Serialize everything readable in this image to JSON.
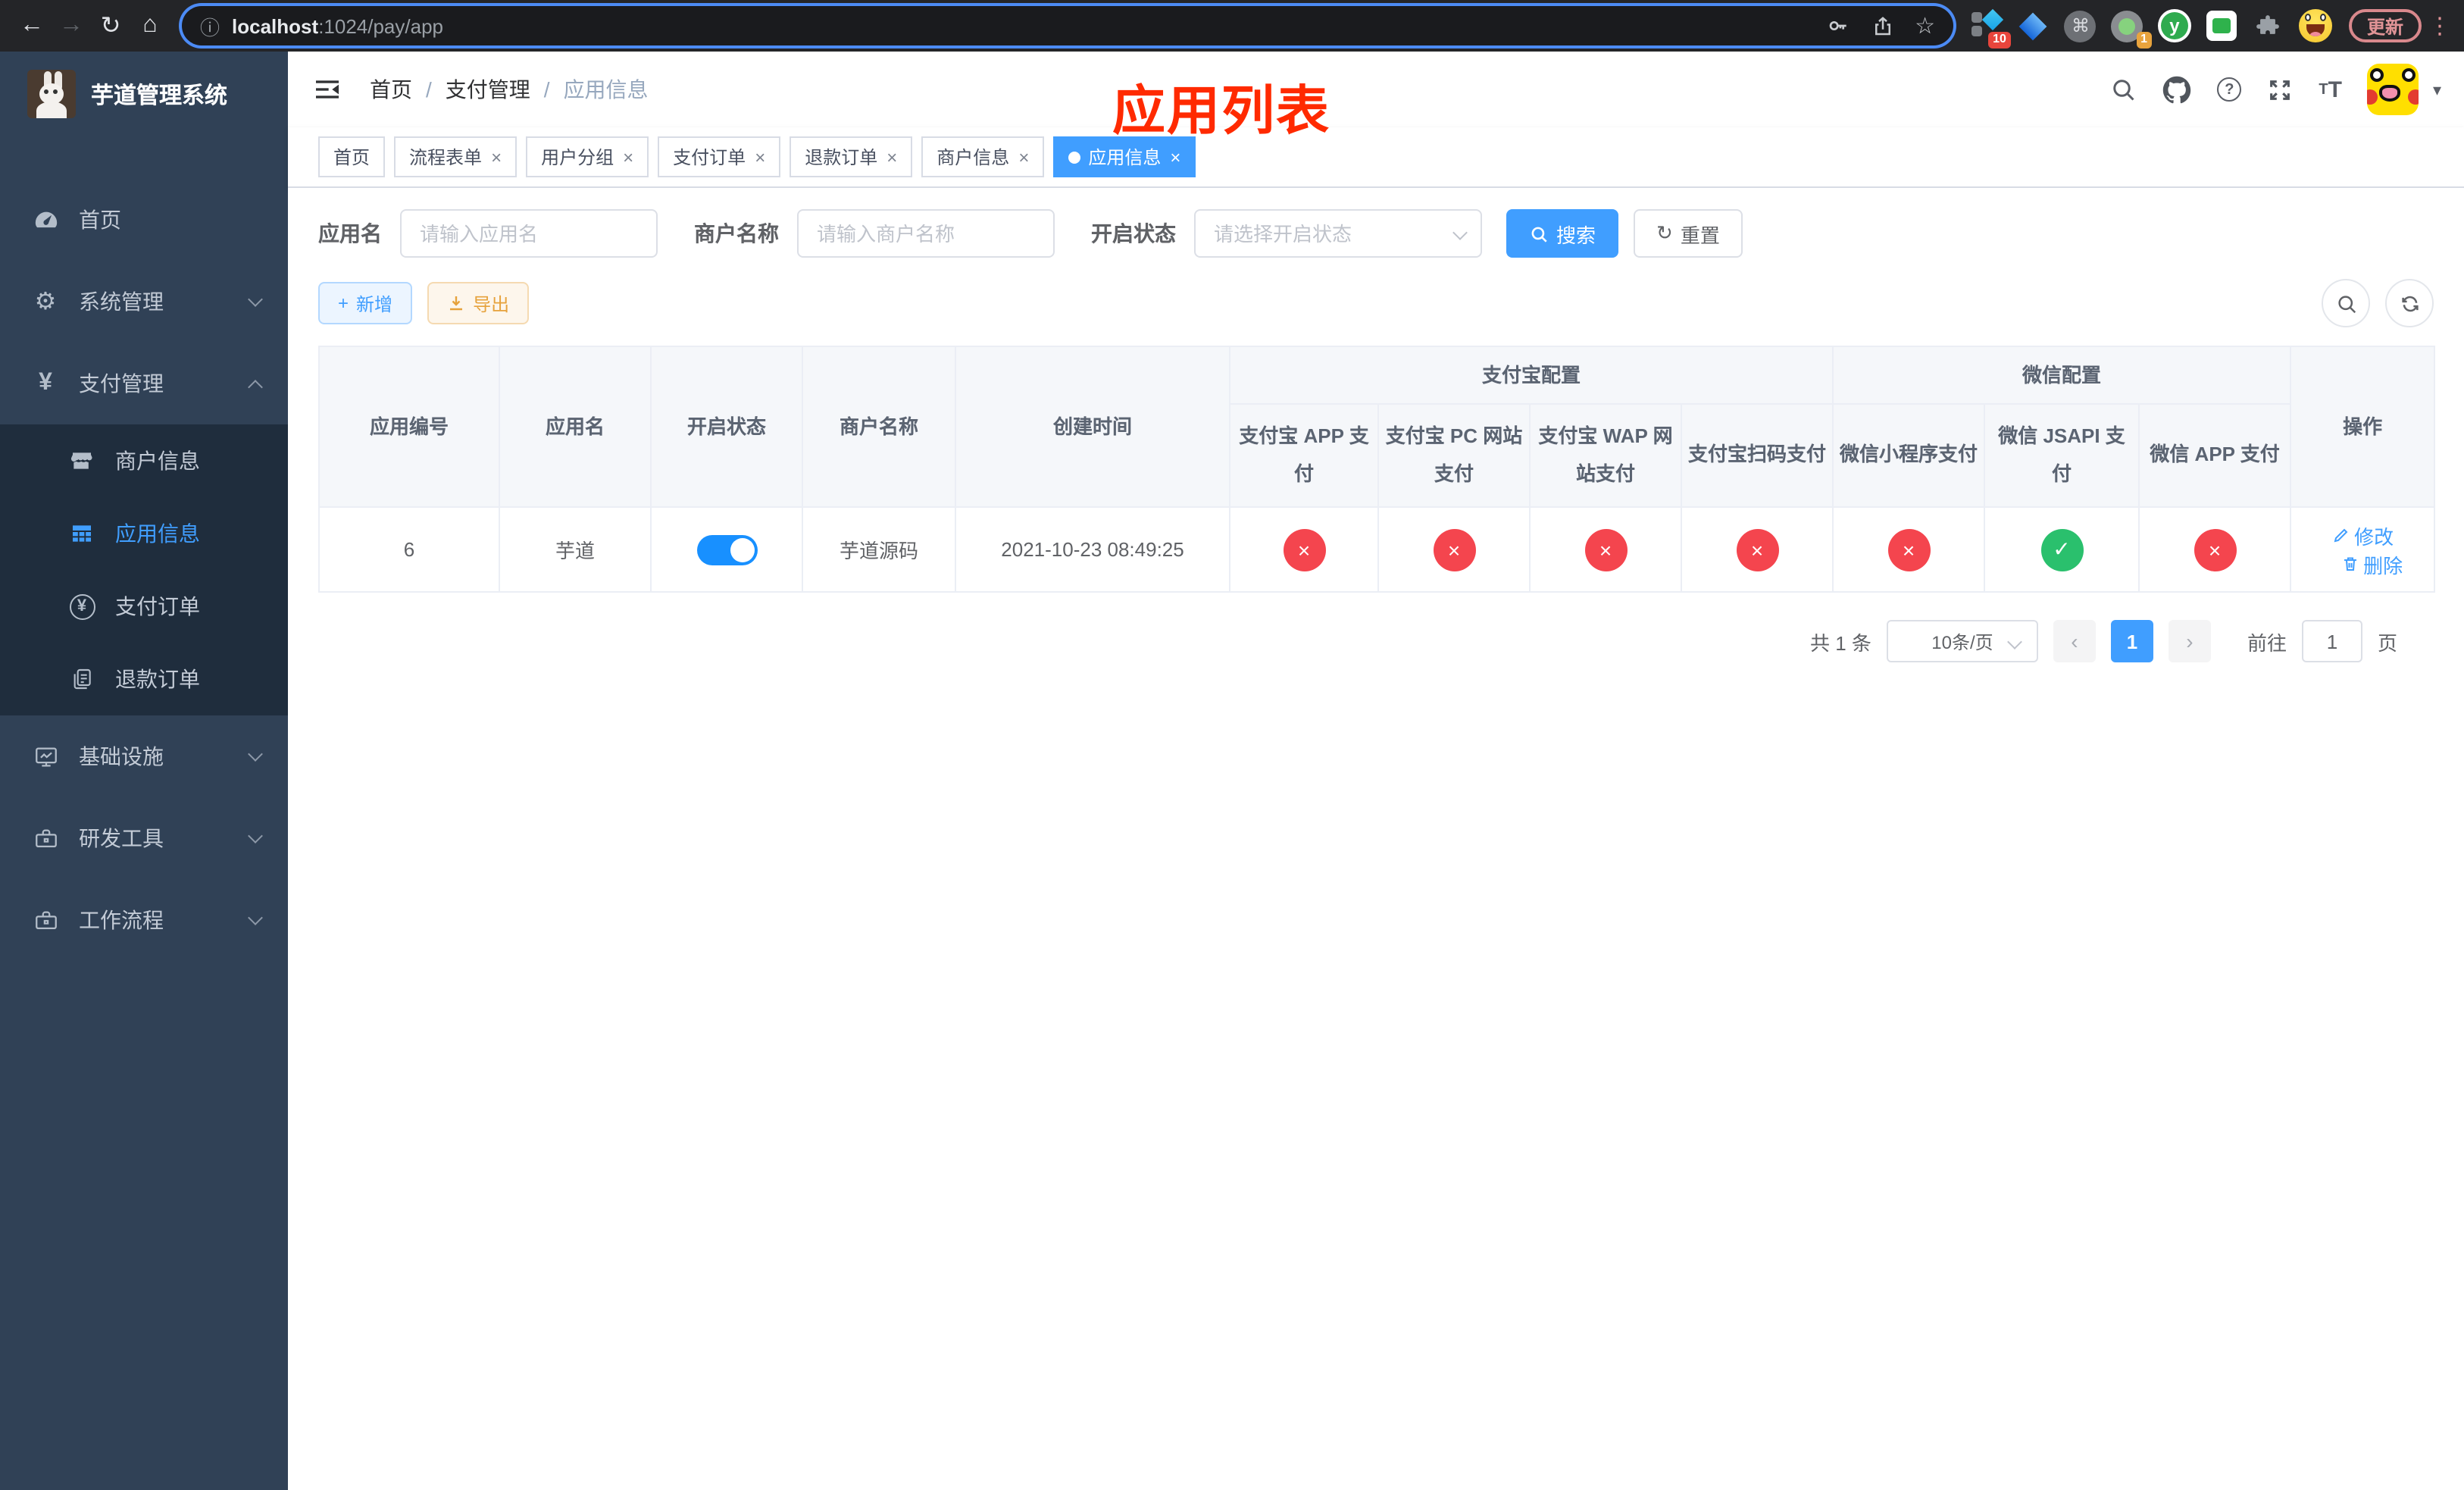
{
  "browser": {
    "url_host": "localhost",
    "url_rest": ":1024/pay/app",
    "update_label": "更新",
    "ext_pin_badge": "10",
    "ext_proxy_badge": "1",
    "ext_y_letter": "y"
  },
  "icons": {
    "back": "←",
    "forward": "→",
    "reload": "↻",
    "home": "⌂",
    "info": "ⓘ",
    "star": "☆",
    "command": "⌘",
    "dots": "⋮",
    "caret_down": "▾",
    "help": "?",
    "check": "✓",
    "cross": "×",
    "yuan": "¥",
    "prev": "‹",
    "next": "›",
    "gear": "⚙",
    "refresh": "↻",
    "plus": "+"
  },
  "sidebar": {
    "logo_title": "芋道管理系统",
    "home": "首页",
    "system": "系统管理",
    "payment": "支付管理",
    "merchant_info": "商户信息",
    "app_info": "应用信息",
    "pay_order": "支付订单",
    "refund_order": "退款订单",
    "infrastructure": "基础设施",
    "dev_tools": "研发工具",
    "workflow": "工作流程"
  },
  "navbar": {
    "breadcrumb": [
      "首页",
      "支付管理",
      "应用信息"
    ]
  },
  "annotation": "应用列表",
  "tabs": [
    {
      "label": "首页"
    },
    {
      "label": "流程表单"
    },
    {
      "label": "用户分组"
    },
    {
      "label": "支付订单"
    },
    {
      "label": "退款订单"
    },
    {
      "label": "商户信息"
    },
    {
      "label": "应用信息"
    }
  ],
  "search": {
    "app_label": "应用名",
    "app_placeholder": "请输入应用名",
    "merchant_label": "商户名称",
    "merchant_placeholder": "请输入商户名称",
    "status_label": "开启状态",
    "status_placeholder": "请选择开启状态",
    "search_label": "搜索",
    "reset_label": "重置"
  },
  "toolbar": {
    "add_label": "新增",
    "export_label": "导出"
  },
  "table": {
    "col_id": "应用编号",
    "col_name": "应用名",
    "col_status": "开启状态",
    "col_merchant": "商户名称",
    "col_created": "创建时间",
    "group_alipay": "支付宝配置",
    "group_wechat": "微信配置",
    "channel_cols": [
      "支付宝 APP 支付",
      "支付宝 PC 网站支付",
      "支付宝 WAP 网站支付",
      "支付宝扫码支付",
      "微信小程序支付",
      "微信 JSAPI 支付",
      "微信 APP 支付"
    ],
    "col_actions": "操作",
    "row": {
      "id": "6",
      "name": "芋道",
      "enabled": true,
      "merchant": "芋道源码",
      "created": "2021-10-23 08:49:25",
      "channels": [
        false,
        false,
        false,
        false,
        false,
        true,
        false
      ],
      "edit_label": "修改",
      "delete_label": "删除"
    }
  },
  "pagination": {
    "total": "共 1 条",
    "page_size": "10条/页",
    "current_page": "1",
    "goto_label": "前往",
    "goto_value": "1",
    "page_unit": "页"
  },
  "colors": {
    "accent": "#409eff",
    "success": "#2ac06d",
    "danger": "#f4454e",
    "warning": "#e6a23c",
    "annotation_red": "#ff2a00",
    "sidebar_bg": "#304156",
    "sidebar_submenu_bg": "#1f2d3d"
  }
}
